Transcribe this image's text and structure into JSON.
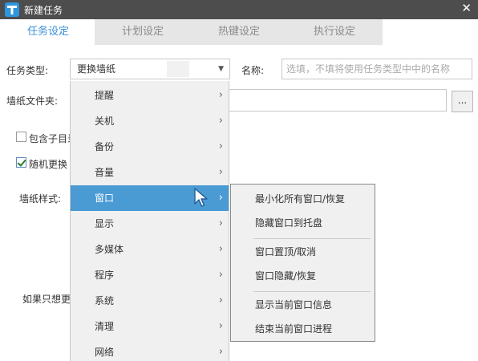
{
  "window": {
    "title": "新建任务",
    "close_glyph": "✕",
    "app_icon_letter": "T"
  },
  "tabs": [
    {
      "label": "任务设定",
      "active": true
    },
    {
      "label": "计划设定",
      "active": false
    },
    {
      "label": "热键设定",
      "active": false
    },
    {
      "label": "执行设定",
      "active": false
    }
  ],
  "form": {
    "task_type_label": "任务类型:",
    "task_type_value": "更换墙纸",
    "name_label": "名称:",
    "name_placeholder": "选填，不填将使用任务类型中中的名称",
    "folder_label": "墙纸文件夹:",
    "browse_label": "...",
    "include_subdirs_label": "包含子目录",
    "include_subdirs_checked": false,
    "random_change_label": "随机更换",
    "random_change_checked": true,
    "style_label": "墙纸样式:",
    "hint_text": "如果只想更"
  },
  "dropdown": {
    "items": [
      {
        "label": "提醒"
      },
      {
        "label": "关机"
      },
      {
        "label": "备份"
      },
      {
        "label": "音量"
      },
      {
        "label": "窗口",
        "highlighted": true
      },
      {
        "label": "显示"
      },
      {
        "label": "多媒体"
      },
      {
        "label": "程序"
      },
      {
        "label": "系统"
      },
      {
        "label": "清理"
      },
      {
        "label": "网络"
      }
    ],
    "chevron": "›"
  },
  "submenu": {
    "items": [
      "最小化所有窗口/恢复",
      "隐藏窗口到托盘",
      "窗口置顶/取消",
      "窗口隐藏/恢复",
      "显示当前窗口信息",
      "结束当前窗口进程"
    ]
  },
  "colors": {
    "titlebar": "#4d4d4d",
    "accent": "#3a8fd9",
    "highlight": "#4a9ad4",
    "menu_bg": "#f0f0f0"
  },
  "icons": {
    "app": "app-logo-icon",
    "close": "close-icon",
    "chevron": "chevron-right-icon",
    "dropdown_arrow": "chevron-down-icon",
    "cursor": "mouse-pointer-icon",
    "check": "checkmark-icon"
  }
}
